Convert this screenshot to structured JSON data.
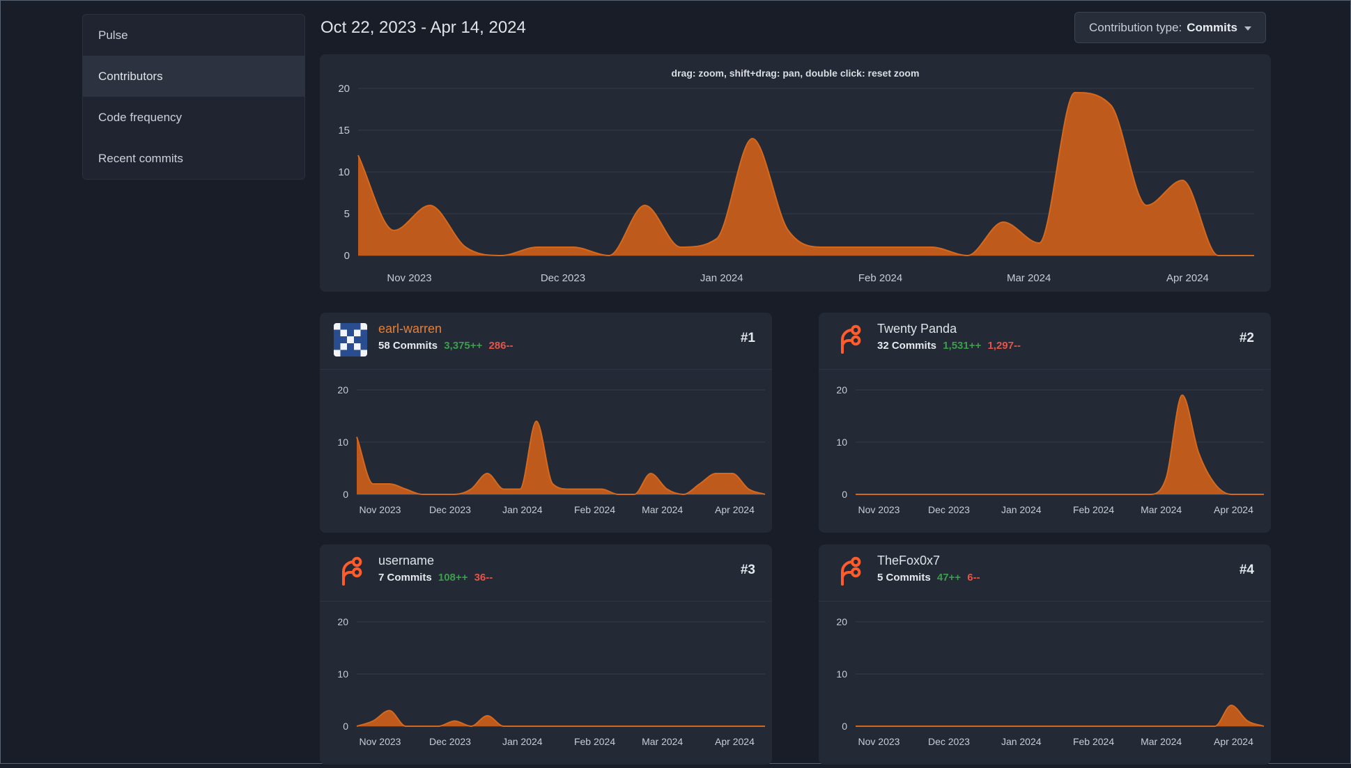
{
  "colors": {
    "page_bg": "#181d27",
    "panel_bg": "#232935",
    "area_fill": "#bf5a1d",
    "area_stroke": "#d4691e",
    "additions_green": "#3c9e4d",
    "deletions_red": "#e5544b",
    "link_orange": "#e1813b",
    "grid_line": "#343b47",
    "axis_text": "#c8cdd5"
  },
  "sidebar": {
    "items": [
      {
        "label": "Pulse",
        "active": false
      },
      {
        "label": "Contributors",
        "active": true
      },
      {
        "label": "Code frequency",
        "active": false
      },
      {
        "label": "Recent commits",
        "active": false
      }
    ]
  },
  "header": {
    "date_range": "Oct 22, 2023 - Apr 14, 2024",
    "contribution_type_label": "Contribution type:",
    "contribution_type_value": "Commits",
    "dropdown_caret": "caret-down-icon"
  },
  "main_chart": {
    "hint": "drag: zoom, shift+drag: pan, double click: reset zoom"
  },
  "contributors": [
    {
      "rank": "#1",
      "name": "earl-warren",
      "name_color": "#e1813b",
      "commits": "58 Commits",
      "additions": "3,375++",
      "deletions": "286--",
      "avatar": "identicon-blue-white"
    },
    {
      "rank": "#2",
      "name": "Twenty Panda",
      "name_color": "#dfe3e8",
      "commits": "32 Commits",
      "additions": "1,531++",
      "deletions": "1,297--",
      "avatar": "forgejo-logo"
    },
    {
      "rank": "#3",
      "name": "username",
      "name_color": "#dfe3e8",
      "commits": "7 Commits",
      "additions": "108++",
      "deletions": "36--",
      "avatar": "forgejo-logo"
    },
    {
      "rank": "#4",
      "name": "TheFox0x7",
      "name_color": "#dfe3e8",
      "commits": "5 Commits",
      "additions": "47++",
      "deletions": "6--",
      "avatar": "forgejo-logo"
    }
  ],
  "chart_data": [
    {
      "id": "total-commits",
      "type": "area",
      "title": "Commits per week (all contributors)",
      "x_unit": "week",
      "x_start": "Oct 22, 2023",
      "x_end": "Apr 14, 2024",
      "x_labels": [
        "Nov 2023",
        "Dec 2023",
        "Jan 2024",
        "Feb 2024",
        "Mar 2024",
        "Apr 2024"
      ],
      "values": [
        12,
        3,
        6,
        1,
        0,
        1,
        1,
        0,
        6,
        1,
        2,
        14,
        3,
        1,
        1,
        1,
        1,
        0,
        4,
        1.5,
        19.5,
        18,
        6,
        9,
        0,
        0
      ],
      "ylim": [
        0,
        20
      ],
      "yticks": [
        0,
        5,
        10,
        15,
        20
      ],
      "grid": "horizontal"
    },
    {
      "id": "earl-warren-commits",
      "type": "area",
      "title": "earl-warren commits per week",
      "x_unit": "week",
      "x_start": "Oct 22, 2023",
      "x_end": "Apr 14, 2024",
      "x_labels": [
        "Nov 2023",
        "Dec 2023",
        "Jan 2024",
        "Feb 2024",
        "Mar 2024",
        "Apr 2024"
      ],
      "values": [
        11,
        2,
        2,
        1,
        0,
        0,
        0,
        1,
        4,
        1,
        1,
        14,
        2,
        1,
        1,
        1,
        0,
        0,
        4,
        1,
        0,
        2,
        4,
        4,
        1,
        0
      ],
      "ylim": [
        0,
        20
      ],
      "yticks": [
        0,
        10,
        20
      ],
      "grid": "horizontal"
    },
    {
      "id": "twenty-panda-commits",
      "type": "area",
      "title": "Twenty Panda commits per week",
      "x_unit": "week",
      "x_start": "Oct 22, 2023",
      "x_end": "Apr 14, 2024",
      "x_labels": [
        "Nov 2023",
        "Dec 2023",
        "Jan 2024",
        "Feb 2024",
        "Mar 2024",
        "Apr 2024"
      ],
      "values": [
        0,
        0,
        0,
        0,
        0,
        0,
        0,
        0,
        0,
        0,
        0,
        0,
        0,
        0,
        0,
        0,
        0,
        0,
        0,
        3,
        19,
        8,
        2,
        0,
        0,
        0
      ],
      "ylim": [
        0,
        20
      ],
      "yticks": [
        0,
        10,
        20
      ],
      "grid": "horizontal"
    },
    {
      "id": "username-commits",
      "type": "area",
      "title": "username commits per week",
      "x_unit": "week",
      "x_start": "Oct 22, 2023",
      "x_end": "Apr 14, 2024",
      "x_labels": [
        "Nov 2023",
        "Dec 2023",
        "Jan 2024",
        "Feb 2024",
        "Mar 2024",
        "Apr 2024"
      ],
      "values": [
        0,
        1,
        3,
        0,
        0,
        0,
        1,
        0,
        2,
        0,
        0,
        0,
        0,
        0,
        0,
        0,
        0,
        0,
        0,
        0,
        0,
        0,
        0,
        0,
        0,
        0
      ],
      "ylim": [
        0,
        20
      ],
      "yticks": [
        0,
        10,
        20
      ],
      "grid": "horizontal"
    },
    {
      "id": "thefox0x7-commits",
      "type": "area",
      "title": "TheFox0x7 commits per week",
      "x_unit": "week",
      "x_start": "Oct 22, 2023",
      "x_end": "Apr 14, 2024",
      "x_labels": [
        "Nov 2023",
        "Dec 2023",
        "Jan 2024",
        "Feb 2024",
        "Mar 2024",
        "Apr 2024"
      ],
      "values": [
        0,
        0,
        0,
        0,
        0,
        0,
        0,
        0,
        0,
        0,
        0,
        0,
        0,
        0,
        0,
        0,
        0,
        0,
        0,
        0,
        0,
        0,
        0,
        4,
        1,
        0
      ],
      "ylim": [
        0,
        20
      ],
      "yticks": [
        0,
        10,
        20
      ],
      "grid": "horizontal"
    }
  ]
}
